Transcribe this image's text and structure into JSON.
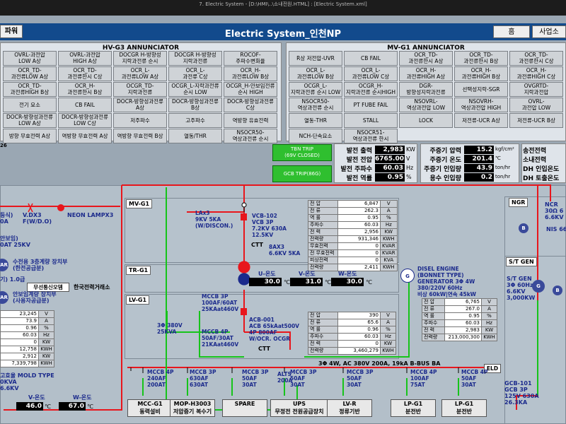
{
  "window": {
    "titlebar": "7. Electric System - [D:\\HMI\\..\\소내전원.HTML] : [Electric System.xml]"
  },
  "header": {
    "left_button": "파워",
    "title": "Electric System_인천NP",
    "home_button": "홈",
    "right_button": "사업소"
  },
  "hv_annunciator": {
    "title": "HV-G3 ANNUNCIATOR",
    "buttons": [
      [
        "OVRL-과전압\nLOW A상",
        "OVRL-과전압\nHIGH A상",
        "DOCGR H-방향성\n지락과전류 순시",
        "DOCGR H-방향성\n지락과전류",
        "ROCOF-\n주파수변화율"
      ],
      [
        "OCR_TD-\n과전류LOW A상",
        "OCR_TD-\n과전류한시 C상",
        "OCR_L-\n과전류LOW A상",
        "OCR_L-\n과전류 C상",
        "OCR_H-\n과전류LOW B상"
      ],
      [
        "OCR_TD-\n과전류HIGH B상",
        "OCR_H-\n과전류한시 B상",
        "OCGR_TD-\n지락과전류",
        "OCGR_L-지락과전류\n순시 LOW",
        "OCGR_H-안보임전류\n순시 HIGH"
      ],
      [
        "전기 요소",
        "CB FAIL",
        "DOCR-방향성과전류\nA상",
        "DOCR-방향성과전류\nB상",
        "DOCR-방향성과전류\nC상"
      ],
      [
        "DOCR-방향성과전류\nLOW A상",
        "DOCR-방향성과전류\nLOW C상",
        "저주파수",
        "고주파수",
        "역방향 유효전력"
      ],
      [
        "방향 무효전력 A상",
        "역방향 무효전력 A상",
        "역방향 무효전력 B상",
        "열동/THR",
        "NSOCR50-\n역상과전류 순시"
      ]
    ],
    "left_indicator": "26"
  },
  "mv_annunciator": {
    "title": "MV-G1 ANNUNCIATOR",
    "buttons": [
      [
        "R상 저전압-UVR",
        "CB FAIL",
        "OCR_TD-\n과전류한시 A상",
        "OCR_TD-\n과전류한시 B상",
        "OCR_TD-\n과전류한시 C상"
      ],
      [
        "OCR_L-\n과전류LOW B상",
        "OCR_L-\n과전류LOW C상",
        "OCR_H-\n과전류HIGH A상",
        "OCR_H-\n과전류HIGH B상",
        "OCR_H-\n과전류HIGH C상"
      ],
      [
        "OCGR_L-\n지락과전류 순시 LOW",
        "OCGR_H-\n지락과전류 순시HIGH",
        "DGR-\n방향성지락과전류",
        "선택성지락-SGR",
        "OVGRTD-\n지락과전압"
      ],
      [
        "NSOCR50-\n역상과전류 순시",
        "PT FUBE FAIL",
        "NSOVRL-\n역상과전압 LOW",
        "NSOVRH-\n역상과전압 HIGH",
        "OVRL-\n과전압 LOW"
      ],
      [
        "열동-THR",
        "STALL",
        "LOCK",
        "저전류-UCR A상",
        "저전류-UCR B상"
      ],
      [
        "NCH-단속요소",
        "NSOCR51-\n역상과전류 한시"
      ]
    ]
  },
  "trip_buttons": {
    "tbn_trip": "TBN TRIP\n(69V CLOSED)",
    "gcb_trip": "GCB TRIP(86G)"
  },
  "gen_data": {
    "rows": [
      {
        "label": "발전 출력",
        "value": "2,983",
        "unit": "KW"
      },
      {
        "label": "발전 전압",
        "value": "6765.00",
        "unit": "V"
      },
      {
        "label": "발전 주파수",
        "value": "60.03",
        "unit": "Hz"
      },
      {
        "label": "발전 역률",
        "value": "0.95",
        "unit": "%"
      }
    ]
  },
  "steam_data": {
    "rows": [
      {
        "label": "주증기 압력",
        "value": "15.2",
        "unit": "kgf/cm²"
      },
      {
        "label": "주증기 온도",
        "value": "201.4",
        "unit": "℃"
      },
      {
        "label": "주증기 인입량",
        "value": "43.9",
        "unit": "ton/hr"
      },
      {
        "label": "용수 인입량",
        "value": "0.2",
        "unit": "ton/hr"
      }
    ]
  },
  "right_data": {
    "rows": [
      "송전전력",
      "소내전력",
      "DH 인입온도",
      "DH 토출온도"
    ]
  },
  "sections": {
    "mv": "MV-G1",
    "tr": "TR-G1",
    "lv": "LV-G1",
    "ngr": "NGR",
    "st_gen": "S/T GEN"
  },
  "left_labels": {
    "item1": "등식)\n0A",
    "vdx": "V.DX3\nF(W/D.O)",
    "neon": "NEON LAMPX3",
    "anbo": "안보임)\n0AT 25KV",
    "suzeon": "수전용 3층계량 장치부\n(한전공급분)",
    "pt": "기) 1.0급",
    "comm_box": "무선통신모뎀",
    "kepco": "한국전력거래소",
    "anbo2": "안보임계량 장치부\n(사용자공급분)",
    "mold": "고효율 MOLD TYPE\n0KVA\n6.6KV",
    "v_temp_label": "V-온도",
    "w_temp_label": "W-온도",
    "v_temp": "46.0",
    "w_temp": "67.0",
    "temp_unit": "℃"
  },
  "left_table": {
    "rows": [
      {
        "label": "",
        "value": "23,245",
        "unit": "V"
      },
      {
        "label": "",
        "value": "73.9",
        "unit": "A"
      },
      {
        "label": "",
        "value": "0.96",
        "unit": "%"
      },
      {
        "label": "",
        "value": "60.03",
        "unit": "Hz"
      },
      {
        "label": "",
        "value": "0",
        "unit": "KW"
      },
      {
        "label": "",
        "value": "12,758",
        "unit": "KWH"
      },
      {
        "label": "",
        "value": "2,912",
        "unit": "KW"
      },
      {
        "label": "",
        "value": "7,339,798",
        "unit": "KWH"
      }
    ]
  },
  "mv_table": {
    "rows": [
      {
        "label": "전 압",
        "value": "6,847",
        "unit": "V"
      },
      {
        "label": "전 류",
        "value": "262.3",
        "unit": "A"
      },
      {
        "label": "역 률",
        "value": "0.95",
        "unit": "%"
      },
      {
        "label": "주파수",
        "value": "60.03",
        "unit": "Hz"
      },
      {
        "label": "전 력",
        "value": "2,956",
        "unit": "KW"
      },
      {
        "label": "전력량",
        "value": "931,346",
        "unit": "KWH"
      },
      {
        "label": "무효전력",
        "value": "0",
        "unit": "KVAR"
      },
      {
        "label": "전 무효전력",
        "value": "0",
        "unit": "KVAR"
      },
      {
        "label": "피상전력",
        "value": "0",
        "unit": "KVA"
      },
      {
        "label": "전력량",
        "value": "2,411",
        "unit": "KWH"
      }
    ]
  },
  "mv_labels": {
    "lax": "LAx3\n9KV 5KA\n(W/DISCON.)",
    "vcb": "VCB-102\nVCB 3P\n7.2KV 630A\n12.5KV",
    "ctt": "CTT",
    "bax": "8AX3\n6.6KV 5KA"
  },
  "tr_temps": {
    "u_label": "U-온도",
    "v_label": "V-온도",
    "w_label": "W-온도",
    "u": "30.0",
    "v": "31.0",
    "w": "30.0",
    "unit": "℃"
  },
  "lv_table": {
    "rows": [
      {
        "label": "전 압",
        "value": "390",
        "unit": "V"
      },
      {
        "label": "전 류",
        "value": "65.6",
        "unit": "A"
      },
      {
        "label": "역 률",
        "value": "0.96",
        "unit": "%"
      },
      {
        "label": "주파수",
        "value": "60.03",
        "unit": "Hz"
      },
      {
        "label": "전 력",
        "value": "0",
        "unit": "KW"
      },
      {
        "label": "전력량",
        "value": "3,460,279",
        "unit": "KWH"
      }
    ]
  },
  "lv_labels": {
    "mccb1": "MCCB 3P\n100AF/60AT\n25KAat460V",
    "mccb2": "MCCB 4P\n50AF/30AT\n21KAat460V",
    "acb": "ACB-001\nACB 65kAat500V\n4P 800AF\nW/OCR. OCGR",
    "ctt": "CTT",
    "three_phase": "3Φ 380V\n25KVA",
    "bus": "3Φ 4W, AC 380V 200A, 19kA B-BUS BA",
    "alts": "ALTS\n200A"
  },
  "diesel": {
    "title": "DISEL ENGINE\n(BONNET TYPE)\nGENERATOR 3Φ 4W\n380/220V 60Hz\n비상 60kW|연속 45kW",
    "rows": [
      {
        "label": "전 압",
        "value": "6,765",
        "unit": "V"
      },
      {
        "label": "전 류",
        "value": "267.0",
        "unit": "A"
      },
      {
        "label": "역 률",
        "value": "0.95",
        "unit": "%"
      },
      {
        "label": "주파수",
        "value": "60.03",
        "unit": "Hz"
      },
      {
        "label": "전 력",
        "value": "2,983",
        "unit": "KW"
      },
      {
        "label": "전력량",
        "value": "213,000,300",
        "unit": "KWH"
      }
    ]
  },
  "right_labels": {
    "ncr": "NCR\n30Ω 6\n6.6KV",
    "nis": "NIS 66",
    "stgen": "S/T GEN\n3Φ 60Hz\n6.6KV\n3,000KW",
    "gcb": "GCB-101\nGCB 3P\n125V 630A\n26.3KA",
    "eld": "ELD"
  },
  "feeders": [
    {
      "spec": "MCCB 4P\n240AF\n200AT",
      "label": "MCC-G1\n동력설비"
    },
    {
      "spec": "MCCB 3P\n630AF\n630AT",
      "label": "MOP-H3003\n저압증기 복수기"
    },
    {
      "spec": "MCCB 3P\n50AF\n30AT",
      "label": "SPARE"
    },
    {
      "spec": "MCCB 3P\n50AF\n30AT",
      "label": "UPS\n무정전 전원공급장치"
    },
    {
      "spec": "MCCB 3P\n50AF\n30AT",
      "label": "LV-R\n정류기반"
    },
    {
      "spec": "MCCB 4P\n100AF\n75AT",
      "label": "LP-G1\n분전반"
    },
    {
      "spec": "MCCB 4P\n50AF\n30AT",
      "label": "LP-G1\n분전반"
    }
  ],
  "icon_labels": {
    "b": "B",
    "g": "G",
    "var": "VAR"
  }
}
